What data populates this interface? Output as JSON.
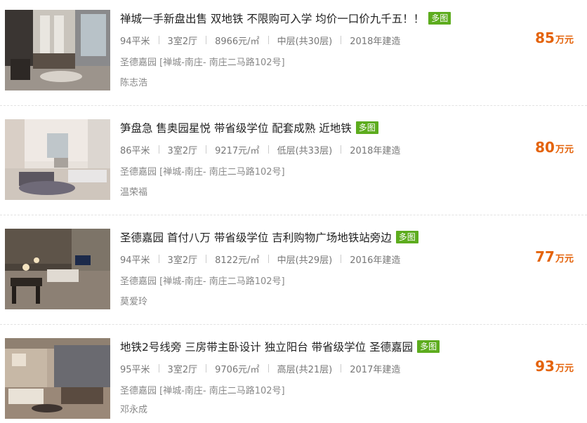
{
  "listings": [
    {
      "title": "禅城一手新盘出售 双地铁 不限购可入学 均价一口价九千五！！",
      "tag": "多图",
      "area": "94平米",
      "layout": "3室2厅",
      "unit_price": "8966元/㎡",
      "floor": "中层(共30层)",
      "year": "2018年建造",
      "address": "圣德嘉园 [禅城-南庄- 南庄二马路102号]",
      "agent": "陈志浩",
      "price": "85",
      "price_unit": "万元"
    },
    {
      "title": "笋盘急 售奥园星悦 带省级学位 配套成熟 近地铁",
      "tag": "多图",
      "area": "86平米",
      "layout": "3室2厅",
      "unit_price": "9217元/㎡",
      "floor": "低层(共33层)",
      "year": "2018年建造",
      "address": "圣德嘉园 [禅城-南庄- 南庄二马路102号]",
      "agent": "温荣福",
      "price": "80",
      "price_unit": "万元"
    },
    {
      "title": "圣德嘉园 首付八万 带省级学位 吉利购物广场地铁站旁边",
      "tag": "多图",
      "area": "94平米",
      "layout": "3室2厅",
      "unit_price": "8122元/㎡",
      "floor": "中层(共29层)",
      "year": "2016年建造",
      "address": "圣德嘉园 [禅城-南庄- 南庄二马路102号]",
      "agent": "莫爱玲",
      "price": "77",
      "price_unit": "万元"
    },
    {
      "title": "地铁2号线旁 三房带主卧设计 独立阳台 带省级学位 圣德嘉园",
      "tag": "多图",
      "area": "95平米",
      "layout": "3室2厅",
      "unit_price": "9706元/㎡",
      "floor": "高层(共21层)",
      "year": "2017年建造",
      "address": "圣德嘉园 [禅城-南庄- 南庄二马路102号]",
      "agent": "邓永成",
      "price": "93",
      "price_unit": "万元"
    }
  ],
  "colors": {
    "price": "#e4630b",
    "tag_bg": "#5dac1e",
    "title": "#222222",
    "meta": "#777777"
  }
}
